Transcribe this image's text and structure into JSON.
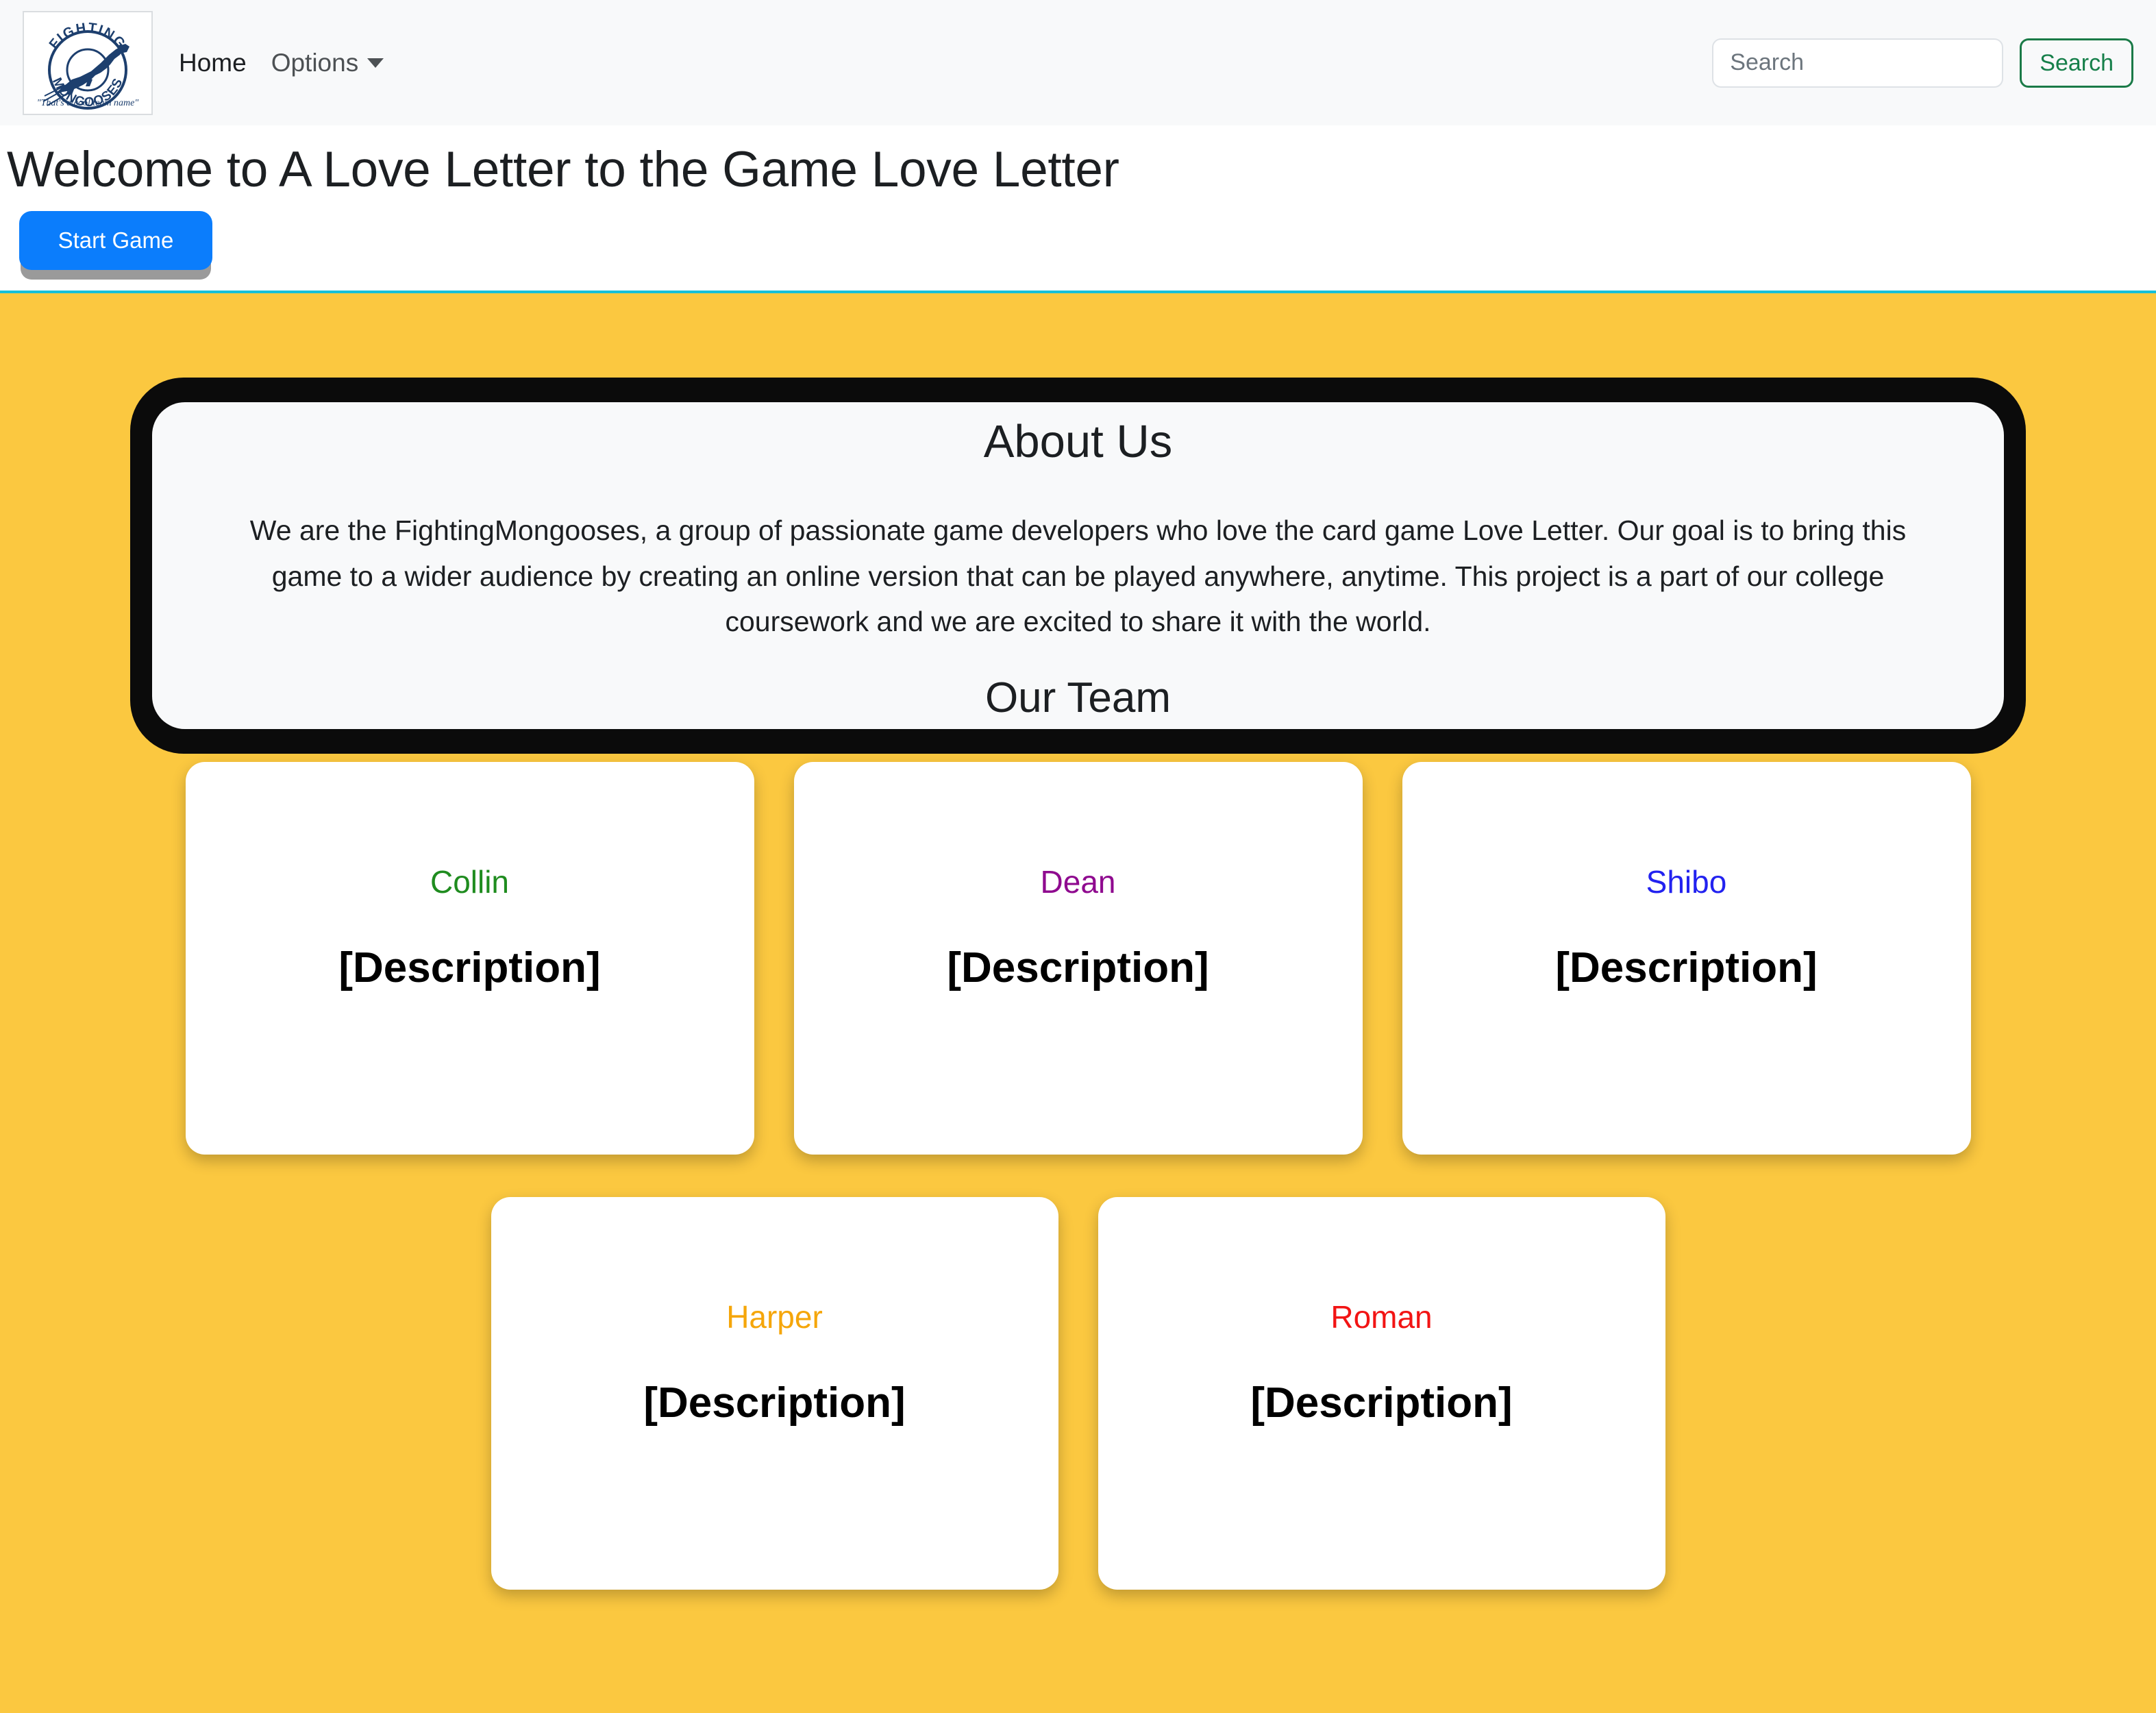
{
  "navbar": {
    "logo": {
      "icon": "fighting-mongooses-logo",
      "arc_top_text": "FIGHTING",
      "arc_bottom_text": "MONGOOSES",
      "tagline": "\"That's a cool team name\""
    },
    "links": [
      {
        "label": "Home",
        "name": "nav-link-home"
      },
      {
        "label": "Options",
        "name": "nav-link-options"
      }
    ],
    "search": {
      "placeholder": "Search",
      "value": "",
      "button_label": "Search"
    }
  },
  "hero": {
    "title": "Welcome to A Love Letter to the Game Love Letter",
    "start_button_label": "Start Game"
  },
  "about": {
    "title": "About Us",
    "body": "We are the FightingMongooses, a group of passionate game developers who love the card game Love Letter. Our goal is to bring this game to a wider audience by creating an online version that can be played anywhere, anytime. This project is a part of our college coursework and we are excited to share it with the world.",
    "team_heading": "Our Team"
  },
  "team": {
    "row1": [
      {
        "name": "Collin",
        "color": "#1f8c1f",
        "description": "[Description]"
      },
      {
        "name": "Dean",
        "color": "#8f0a8f",
        "description": "[Description]"
      },
      {
        "name": "Shibo",
        "color": "#2222f0",
        "description": "[Description]"
      }
    ],
    "row2": [
      {
        "name": "Harper",
        "color": "#f5a60a",
        "description": "[Description]"
      },
      {
        "name": "Roman",
        "color": "#f21414",
        "description": "[Description]"
      }
    ]
  },
  "theme": {
    "background": "#fbc840",
    "navbar_bg": "#f8f9fa",
    "accent_rule": "#17c0d8",
    "start_button_bg": "#0b7dfc",
    "search_button_border": "#1a7a47"
  }
}
